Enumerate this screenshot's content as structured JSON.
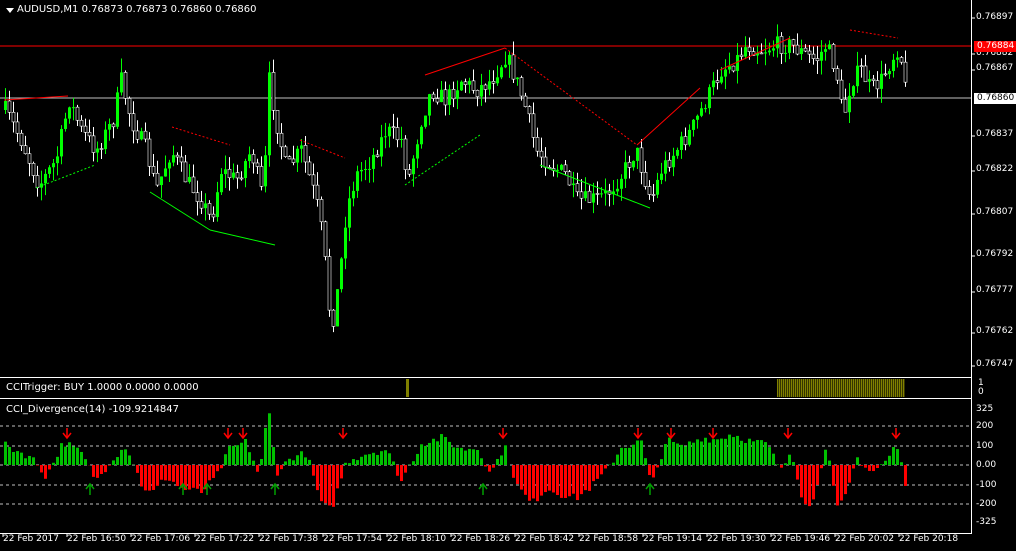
{
  "main_chart": {
    "title": "AUDUSD,M1  0.76873 0.76873 0.76860 0.76860",
    "price_labels": [
      "0.76897",
      "0.76882",
      "0.76867",
      "0.76852",
      "0.76837",
      "0.76822",
      "0.76807",
      "0.76792",
      "0.76777",
      "0.76762",
      "0.76747"
    ],
    "hline_red_label": "0.76884",
    "hline_white_label": "0.76860",
    "colors": {
      "bull": "#00ff00",
      "bear": "#ffffff",
      "line_red": "#ff0000",
      "line_white": "#c0c0c0",
      "tag_red": "#ff0000",
      "bg": "#000000"
    }
  },
  "cci_trigger": {
    "title": "CCITrigger: BUY 1.0000 0.0000 0.0000",
    "scale_top": "1",
    "scale_bottom": "0",
    "color": "#808000"
  },
  "cci_divergence": {
    "title": "CCI_Divergence(14) -109.9214847",
    "levels": [
      "325",
      "200",
      "100",
      "0.00",
      "-100",
      "-200",
      "-325"
    ],
    "colors": {
      "pos": "#00c000",
      "neg": "#ff0000",
      "up_arrow": "#00a000",
      "down_arrow": "#ff0000"
    }
  },
  "time_axis": [
    "22 Feb 2017",
    "22 Feb 16:50",
    "22 Feb 17:06",
    "22 Feb 17:22",
    "22 Feb 17:38",
    "22 Feb 17:54",
    "22 Feb 18:10",
    "22 Feb 18:26",
    "22 Feb 18:42",
    "22 Feb 18:58",
    "22 Feb 19:14",
    "22 Feb 19:30",
    "22 Feb 19:46",
    "22 Feb 20:02",
    "22 Feb 20:18"
  ]
}
